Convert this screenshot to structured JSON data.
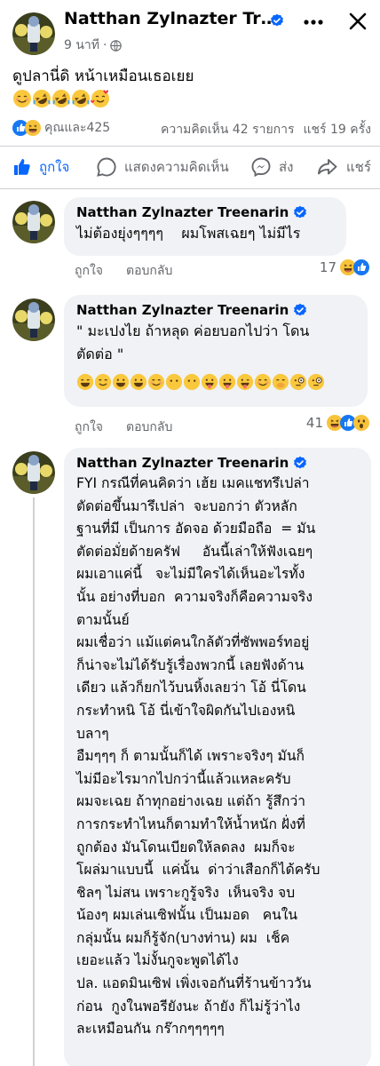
{
  "post": {
    "author": "Natthan Zylnazter Treenarin",
    "timestamp": "9 นาที",
    "meta_separator": "·",
    "text": "ดูปลานี่ดิ หน้าเหมือนเธอเยย",
    "emojis": [
      "smiling-face",
      "rofl",
      "rofl",
      "rofl",
      "smiling-hearts"
    ],
    "reactions_summary": "คุณและ425",
    "reaction_icons": [
      "like-icon",
      "haha-icon"
    ],
    "comments_count": "ความคิดเห็น 42 รายการ",
    "shares_count": "แชร์ 19 ครั้ง"
  },
  "actions": {
    "like": "ถูกใจ",
    "comment": "แสดงความคิดเห็น",
    "send": "ส่ง",
    "share": "แชร์"
  },
  "comments": [
    {
      "author": "Natthan Zylnazter Treenarin",
      "text": "ไม่ต้องยุ่งๆๆๆๆ    ผมโพสเฉยๆ ไม่มีไร",
      "like_label": "ถูกใจ",
      "reply_label": "ตอบกลับ",
      "reaction_count": "17",
      "reaction_icons": [
        "haha-icon",
        "like-icon"
      ]
    },
    {
      "author": "Natthan Zylnazter Treenarin",
      "text": "\" มะเปงไย ถ้าหลุด ค่อยบอกไปว่า โดน\nตัดต่อ \"",
      "emoji_line": [
        "grin",
        "smile",
        "grin",
        "grin",
        "smiling-face",
        "no-mouth",
        "no-mouth",
        "tongue",
        "tongue",
        "winking-tongue",
        "smiling-face",
        "hand-over-mouth",
        "monocle",
        "monocle"
      ],
      "like_label": "ถูกใจ",
      "reply_label": "ตอบกลับ",
      "reaction_count": "41",
      "reaction_icons": [
        "haha-icon",
        "like-icon",
        "wow-icon"
      ]
    },
    {
      "author": "Natthan Zylnazter Treenarin",
      "text": "FYI กรณีที่คนคิดว่า เฮ้ย เมคแชทรึเปล่า\nตัดต่อขึ้นมารึเปล่า  จะบอกว่า ตัวหลัก\nฐานที่มี เป็นการ อัดจอ ด้วยมือถือ  = มัน\nตัดต่อมั่ยด้ายครัฟ     อันนี้เล่าให้ฟังเฉยๆ\nผมเอาแค่นี้   จะไม่มีใครได้เห็นอะไรทั้ง\nนั้น อย่างที่บอก  ความจริงก็คือความจริง\nตามนั้นย์\nผมเชื่อว่า แม้แต่คนใกล้ตัวที่ซัพพอร์ทอยู่\nก็น่าจะไม่ได้รับรู้เรื่องพวกนี้ เลยฟังด้าน\nเดียว แล้วก็ยกไว้บนหิ้งเลยว่า โอ้ นี่โดน\nกระทำหนิ โอ้ นี่เข้าใจผิดกันไปเองหนิ\nบลาๆ\nอืมๆๆๆ ก็ ตามนั้นก็ได้ เพราะจริงๆ มันก็\nไม่มีอะไรมากไปกว่านี้แล้วแหละครับ\nผมจะเฉย ถ้าทุกอย่างเฉย แต่ถ้า รู้สึกว่า\nการกระทำไหนก็ตามทำให้น้ำหนัก ฝั่งที่\nถูกต้อง มันโดนเบียดให้ลดลง  ผมก็จะ\nโผล่มาแบบนี้  แค่นั้น  ด่าว่าเสือกก็ได้ครับ\nชิลๆ ไม่สน เพราะกูรู้จริง  เห็นจริง จบ\nน้องๆ ผมเล่นเซิฟนั้น เป็นมอด   คนใน\nกลุ่มนั้น ผมก็รู้จัก(บางท่าน) ผม  เช็ค\nเยอะแล้ว ไม่งั้นกูจะพูดได้ไง\nปล. แอดมินเซิฟ เพิ่งเจอกันที่ร้านข้าววัน\nก่อน  กูงในพอรียังนะ ถ้ายัง ก็ไม่รู้ว่าไง\nละเหมือนกัน กร๊ากๆๆๆๆๆ"
    }
  ]
}
